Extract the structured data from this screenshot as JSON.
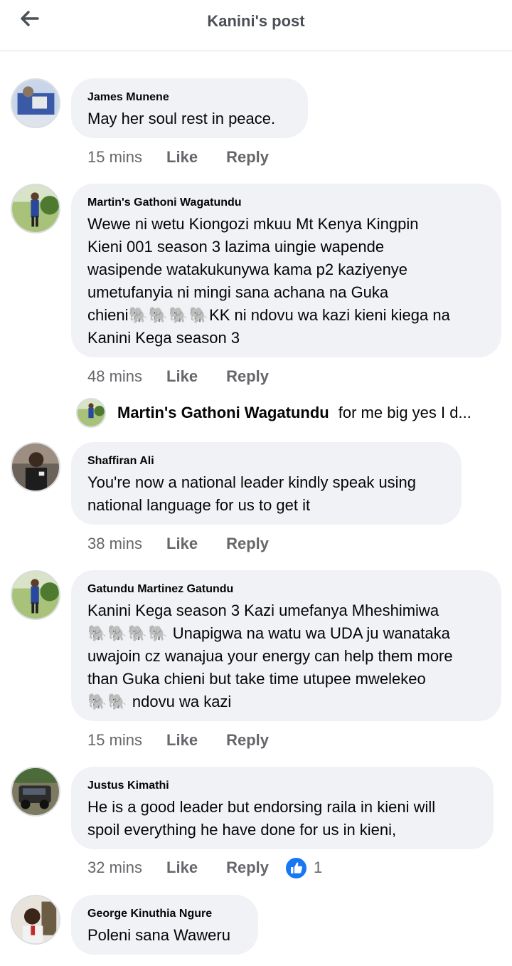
{
  "header": {
    "title": "Kanini's post"
  },
  "comments": [
    {
      "author": "James Munene",
      "text": [
        "May her soul rest in peace."
      ],
      "time": "15 mins",
      "like": "Like",
      "reply": "Reply"
    },
    {
      "author": "Martin's Gathoni Wagatundu",
      "line1": "Wewe ni wetu Kiongozi mkuu Mt Kenya Kingpin",
      "line2": "Kieni 001 season 3 lazima uingie wapende",
      "line3": "wasipende watakukunywa kama p2 kaziyenye",
      "line4": "umetufanyia ni mingi sana achana na Guka",
      "line5a": "chieni",
      "line5emoji": "🐘🐘🐘🐘",
      "line5b": "KK ni ndovu wa kazi kieni kiega na",
      "line6": "Kanini Kega season 3",
      "time": "48 mins",
      "like": "Like",
      "reply": "Reply"
    },
    {
      "author": "Shaffiran Ali",
      "line1": "You're now a national leader kindly speak using",
      "line2": "national language for us to get it",
      "time": "38 mins",
      "like": "Like",
      "reply": "Reply"
    },
    {
      "author": "Gatundu Martinez Gatundu",
      "line1": "Kanini Kega season 3 Kazi umefanya Mheshimiwa",
      "line2emoji": "🐘🐘🐘🐘",
      "line2": " Unapigwa na watu wa UDA ju wanataka",
      "line3": "uwajoin cz wanajua your energy can help them more",
      "line4": "than Guka chieni but take time utupee mwelekeo",
      "line5emoji": "🐘🐘",
      "line5": " ndovu wa kazi",
      "time": "15 mins",
      "like": "Like",
      "reply": "Reply"
    },
    {
      "author": "Justus Kimathi",
      "line1": "He is  a good leader but  endorsing raila in kieni will",
      "line2": "spoil everything he have done for us in kieni,",
      "time": "32 mins",
      "like": "Like",
      "reply": "Reply",
      "reaction_count": "1"
    },
    {
      "author": "George Kinuthia Ngure",
      "line1": "Poleni sana Waweru"
    }
  ],
  "reply_preview": {
    "author": "Martin's Gathoni Wagatundu",
    "snippet": "for me big yes I d..."
  },
  "icons": {
    "back": "back-arrow-icon",
    "like_reaction": "thumbs-up-icon"
  },
  "colors": {
    "bubble": "#f0f2f5",
    "meta": "#65676b",
    "like_blue": "#1877f2"
  }
}
